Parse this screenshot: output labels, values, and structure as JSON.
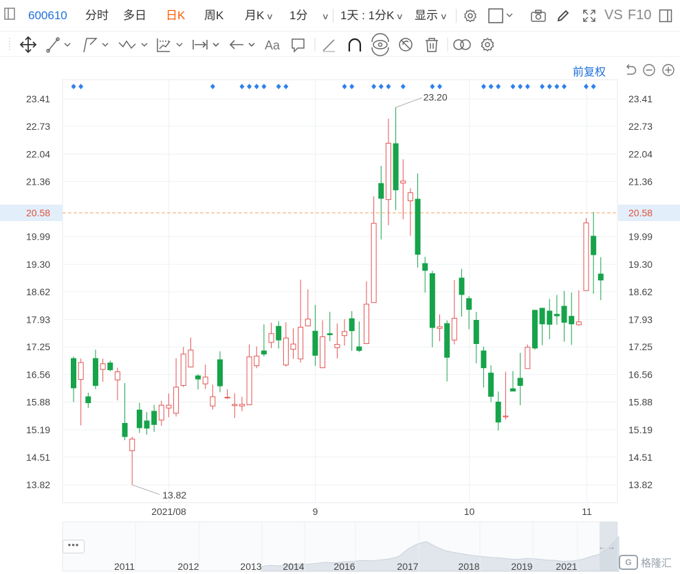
{
  "toolbar": {
    "stock_code": "600610",
    "buttons": {
      "fenshi": "分时",
      "duori": "多日",
      "rik": "日K",
      "zhouk": "周K",
      "yuek": "月K",
      "min": "1分",
      "period": "1天 : 1分K",
      "display": "显示",
      "vs": "VS",
      "f10": "F10"
    },
    "drawing_tools": [
      "move-icon",
      "line-icon",
      "polyline-icon",
      "wave-icon",
      "chart-tool-icon",
      "range-icon",
      "arrow-icon",
      "text-icon",
      "comment-icon",
      "pencil-icon",
      "magnet-icon",
      "eye-link-icon",
      "hide-icon",
      "trash-icon",
      "compare-icon",
      "settings-icon"
    ]
  },
  "chart_controls": {
    "adjust_label": "前复权"
  },
  "chart_data": {
    "type": "candlestick",
    "ylim": [
      13.38,
      23.89
    ],
    "yticks": [
      23.41,
      22.73,
      22.04,
      21.36,
      20.58,
      19.99,
      19.3,
      18.62,
      17.93,
      17.25,
      16.56,
      15.88,
      15.19,
      14.51,
      13.82
    ],
    "current_price": 20.58,
    "high_label": "23.20",
    "low_label": "13.82",
    "xticks": [
      {
        "label": "2021/08",
        "index": 13
      },
      {
        "label": "9",
        "index": 33
      },
      {
        "label": "10",
        "index": 54
      },
      {
        "label": "11",
        "index": 70
      }
    ],
    "candles": [
      [
        16.96,
        16.23,
        17.01,
        15.88
      ],
      [
        16.44,
        16.86,
        16.96,
        15.3
      ],
      [
        16.01,
        15.86,
        16.11,
        15.73
      ],
      [
        16.96,
        16.29,
        17.18,
        16.2
      ],
      [
        16.69,
        16.83,
        16.96,
        16.38
      ],
      [
        16.85,
        16.68,
        16.91,
        16.64
      ],
      [
        16.43,
        16.63,
        16.73,
        15.92
      ],
      [
        15.35,
        15.02,
        16.35,
        14.93
      ],
      [
        14.67,
        14.96,
        15.02,
        13.82
      ],
      [
        15.68,
        15.24,
        15.86,
        15.11
      ],
      [
        15.41,
        15.23,
        15.63,
        15.07
      ],
      [
        15.65,
        15.32,
        15.81,
        15.14
      ],
      [
        15.43,
        15.8,
        15.91,
        15.29
      ],
      [
        15.73,
        15.8,
        16.09,
        15.5
      ],
      [
        15.6,
        16.25,
        16.97,
        15.52
      ],
      [
        16.29,
        17.07,
        17.25,
        16.25
      ],
      [
        16.75,
        17.17,
        17.48,
        16.74
      ],
      [
        16.53,
        16.45,
        16.57,
        16.19
      ],
      [
        16.33,
        16.5,
        16.81,
        16.2
      ],
      [
        15.78,
        16.01,
        16.31,
        15.69
      ],
      [
        16.93,
        16.28,
        17.14,
        16.12
      ],
      [
        16.0,
        16.0,
        16.2,
        15.95
      ],
      [
        15.79,
        15.82,
        16.1,
        15.48
      ],
      [
        15.78,
        15.82,
        16.01,
        15.65
      ],
      [
        15.81,
        17.0,
        17.31,
        15.81
      ],
      [
        16.78,
        17.02,
        17.26,
        16.72
      ],
      [
        17.15,
        17.07,
        17.81,
        17.01
      ],
      [
        17.36,
        17.58,
        17.85,
        17.22
      ],
      [
        17.76,
        17.42,
        17.89,
        17.21
      ],
      [
        16.8,
        17.47,
        17.86,
        16.76
      ],
      [
        17.19,
        17.32,
        17.71,
        16.95
      ],
      [
        16.95,
        17.74,
        18.92,
        16.86
      ],
      [
        17.77,
        17.94,
        18.68,
        17.76
      ],
      [
        17.64,
        17.04,
        18.29,
        16.78
      ],
      [
        16.73,
        17.5,
        17.91,
        16.73
      ],
      [
        17.58,
        17.55,
        18.12,
        17.39
      ],
      [
        17.23,
        17.31,
        17.83,
        16.96
      ],
      [
        17.53,
        17.63,
        17.94,
        17.28
      ],
      [
        17.95,
        17.65,
        18.14,
        17.15
      ],
      [
        17.25,
        17.16,
        17.88,
        17.12
      ],
      [
        17.33,
        18.31,
        18.88,
        17.33
      ],
      [
        18.35,
        20.32,
        20.99,
        18.35
      ],
      [
        21.31,
        20.94,
        21.75,
        19.92
      ],
      [
        20.91,
        22.31,
        22.92,
        20.27
      ],
      [
        22.3,
        21.15,
        23.2,
        20.65
      ],
      [
        21.32,
        21.37,
        21.91,
        20.42
      ],
      [
        20.88,
        21.08,
        21.19,
        20.01
      ],
      [
        20.92,
        19.55,
        21.56,
        19.22
      ],
      [
        19.32,
        19.15,
        19.49,
        18.6
      ],
      [
        19.07,
        17.73,
        19.14,
        17.24
      ],
      [
        17.71,
        17.75,
        18.06,
        17.39
      ],
      [
        17.83,
        16.99,
        17.91,
        16.39
      ],
      [
        17.42,
        17.96,
        18.91,
        17.31
      ],
      [
        18.96,
        18.55,
        19.19,
        18.0
      ],
      [
        18.45,
        18.18,
        18.51,
        17.69
      ],
      [
        17.91,
        17.33,
        18.12,
        16.84
      ],
      [
        17.15,
        16.73,
        17.26,
        16.24
      ],
      [
        16.6,
        16.02,
        16.79,
        15.88
      ],
      [
        15.88,
        15.38,
        16.14,
        15.17
      ],
      [
        15.53,
        15.53,
        16.63,
        15.44
      ],
      [
        16.21,
        16.15,
        16.65,
        16.15
      ],
      [
        16.47,
        16.29,
        17.1,
        15.8
      ],
      [
        16.71,
        17.24,
        17.31,
        16.75
      ],
      [
        18.16,
        17.22,
        17.69,
        17.18
      ],
      [
        18.21,
        17.82,
        18.18,
        17.29
      ],
      [
        18.14,
        17.81,
        18.44,
        17.44
      ],
      [
        18.06,
        18.02,
        18.54,
        17.8
      ],
      [
        18.26,
        17.86,
        18.64,
        17.38
      ],
      [
        18.01,
        17.82,
        18.6,
        17.3
      ],
      [
        17.8,
        17.87,
        18.65,
        17.78
      ],
      [
        18.65,
        20.33,
        20.45,
        18.65
      ],
      [
        20.0,
        19.54,
        20.6,
        18.57
      ],
      [
        19.06,
        18.91,
        19.48,
        18.41
      ]
    ],
    "overview_xlabels": [
      "2011",
      "2012",
      "2013",
      "2014",
      "2016",
      "2017",
      "2018",
      "2019",
      "2021"
    ]
  },
  "colors": {
    "up": "#e25353",
    "down": "#16a34a",
    "accent": "#1e6fd9",
    "active": "#ff5b00",
    "marker": "#2f80ed",
    "price_line": "#f0a45d"
  }
}
